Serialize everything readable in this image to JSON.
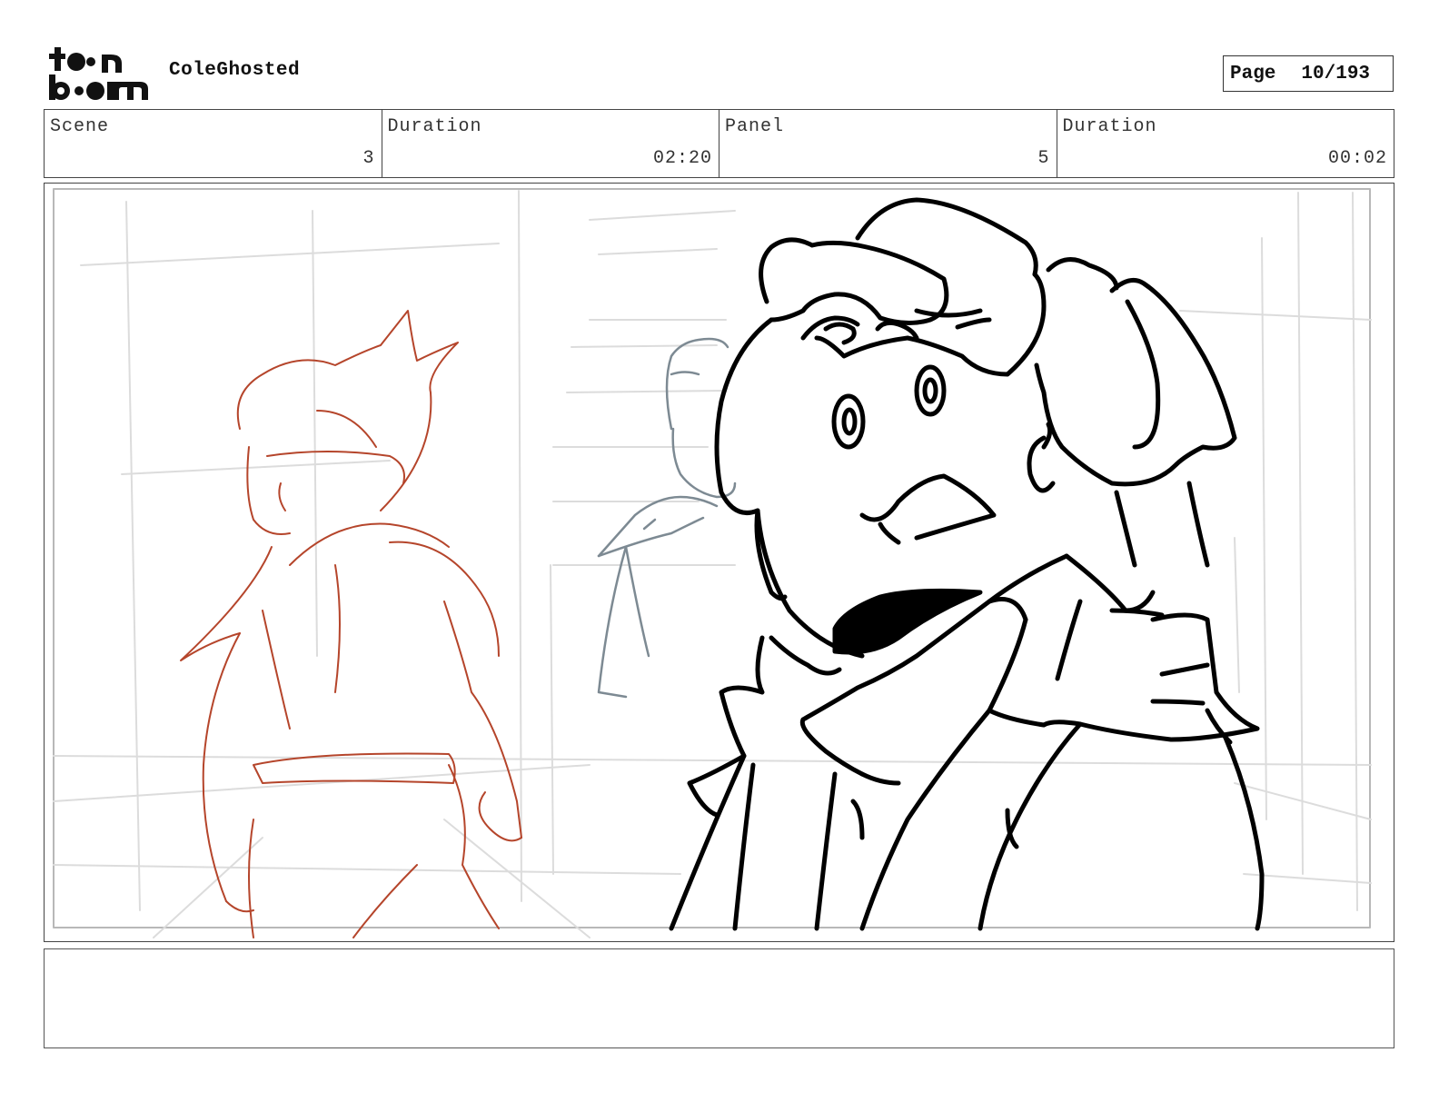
{
  "header": {
    "logo_text": "toon boom",
    "project_title": "ColeGhosted",
    "page_label": "Page",
    "page_number": "10/193"
  },
  "info": {
    "scene_label": "Scene",
    "scene_value": "3",
    "scene_duration_label": "Duration",
    "scene_duration_value": "02:20",
    "panel_label": "Panel",
    "panel_value": "5",
    "panel_duration_label": "Duration",
    "panel_duration_value": "00:02"
  },
  "colors": {
    "red_sketch": "#b5452b",
    "gray_sketch": "#7d8a93",
    "ink": "#000000",
    "guide": "#d8d8d8"
  },
  "notes": {
    "dialogue": ""
  }
}
